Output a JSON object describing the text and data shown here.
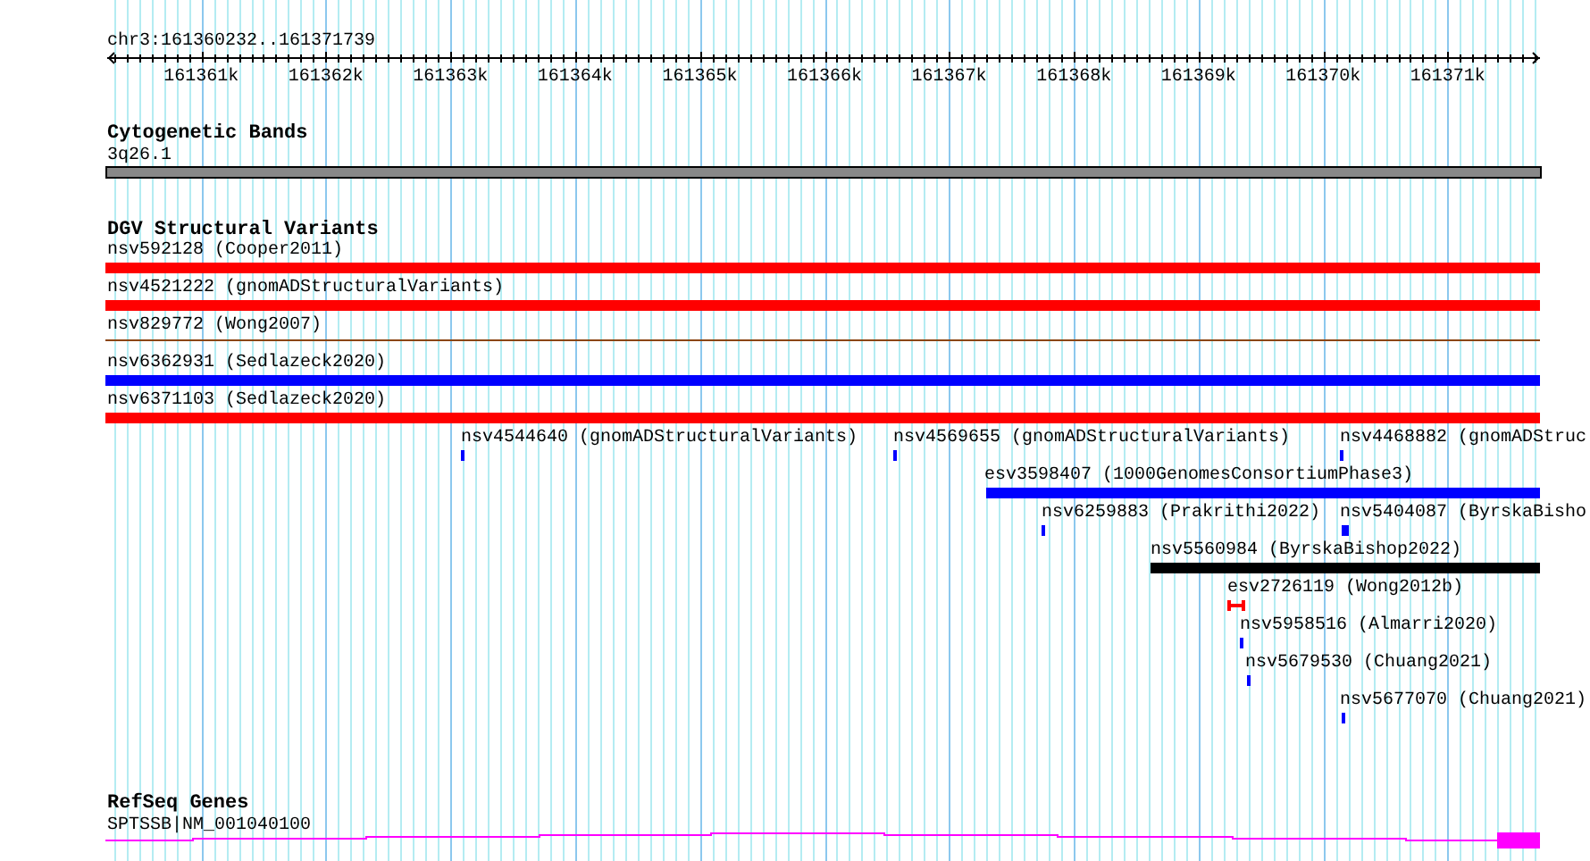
{
  "ruler": {
    "position": "chr3:161360232..161371739",
    "ticks": [
      "161361k",
      "161362k",
      "161363k",
      "161364k",
      "161365k",
      "161366k",
      "161367k",
      "161368k",
      "161369k",
      "161370k",
      "161371k"
    ]
  },
  "tracks": [
    {
      "kind": "cytoband",
      "title": "Cytogenetic Bands",
      "features": [
        {
          "kind": "band",
          "label": "3q26.1"
        }
      ]
    },
    {
      "kind": "variants",
      "title": "DGV Structural Variants",
      "features": [
        {
          "kind": "bar",
          "label": "nsv592128 (Cooper2011)",
          "color": "#ff0000"
        },
        {
          "kind": "bar",
          "label": "nsv4521222 (gnomADStructuralVariants)",
          "color": "#ff0000"
        },
        {
          "kind": "line",
          "label": "nsv829772 (Wong2007)",
          "color": "#8b4513"
        },
        {
          "kind": "bar",
          "label": "nsv6362931 (Sedlazeck2020)",
          "color": "#0000ff"
        },
        {
          "kind": "bar",
          "label": "nsv6371103 (Sedlazeck2020)",
          "color": "#ff0000"
        },
        {
          "kind": "tick",
          "label": "nsv4544640 (gnomADStructuralVariants)",
          "color": "#0000ff"
        },
        {
          "kind": "tick",
          "label": "nsv4569655 (gnomADStructuralVariants)",
          "color": "#0000ff"
        },
        {
          "kind": "tick",
          "label": "nsv4468882 (gnomADStruc",
          "color": "#0000ff"
        },
        {
          "kind": "bar",
          "label": "esv3598407 (1000GenomesConsortiumPhase3)",
          "color": "#0000ff"
        },
        {
          "kind": "tick",
          "label": "nsv6259883 (Prakrithi2022)",
          "color": "#0000ff"
        },
        {
          "kind": "tick",
          "label": "nsv5404087 (ByrskaBisho",
          "color": "#0000ff"
        },
        {
          "kind": "bar",
          "label": "nsv5560984 (ByrskaBishop2022)",
          "color": "#000000"
        },
        {
          "kind": "range",
          "label": "esv2726119 (Wong2012b)",
          "color": "#ff0000"
        },
        {
          "kind": "tick",
          "label": "nsv5958516 (Almarri2020)",
          "color": "#0000ff"
        },
        {
          "kind": "tick",
          "label": "nsv5679530 (Chuang2021)",
          "color": "#0000ff"
        },
        {
          "kind": "tick",
          "label": "nsv5677070 (Chuang2021)",
          "color": "#0000ff"
        }
      ]
    },
    {
      "kind": "genes",
      "title": "RefSeq Genes",
      "features": [
        {
          "kind": "gene",
          "label": "SPTSSB|NM_001040100"
        }
      ]
    }
  ]
}
